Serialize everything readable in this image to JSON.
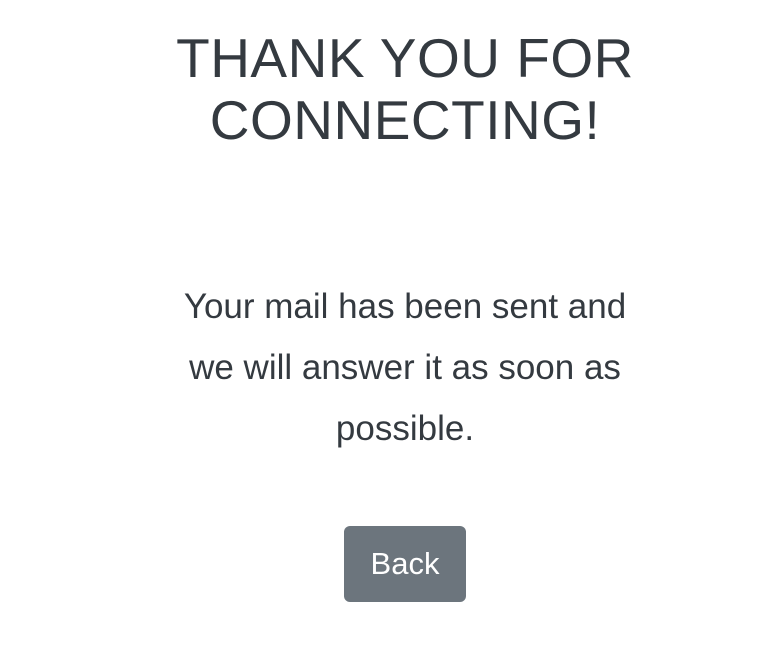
{
  "title": {
    "line1": "THANK YOU FOR",
    "line2": "CONNECTING!"
  },
  "message": {
    "line1": "Your mail has been sent and",
    "line2": "we will answer it as soon as",
    "line3": "possible."
  },
  "actions": {
    "back_label": "Back"
  },
  "colors": {
    "text": "#343a40",
    "button_background": "#6c757d",
    "button_text": "#ffffff",
    "page_background": "#ffffff"
  }
}
